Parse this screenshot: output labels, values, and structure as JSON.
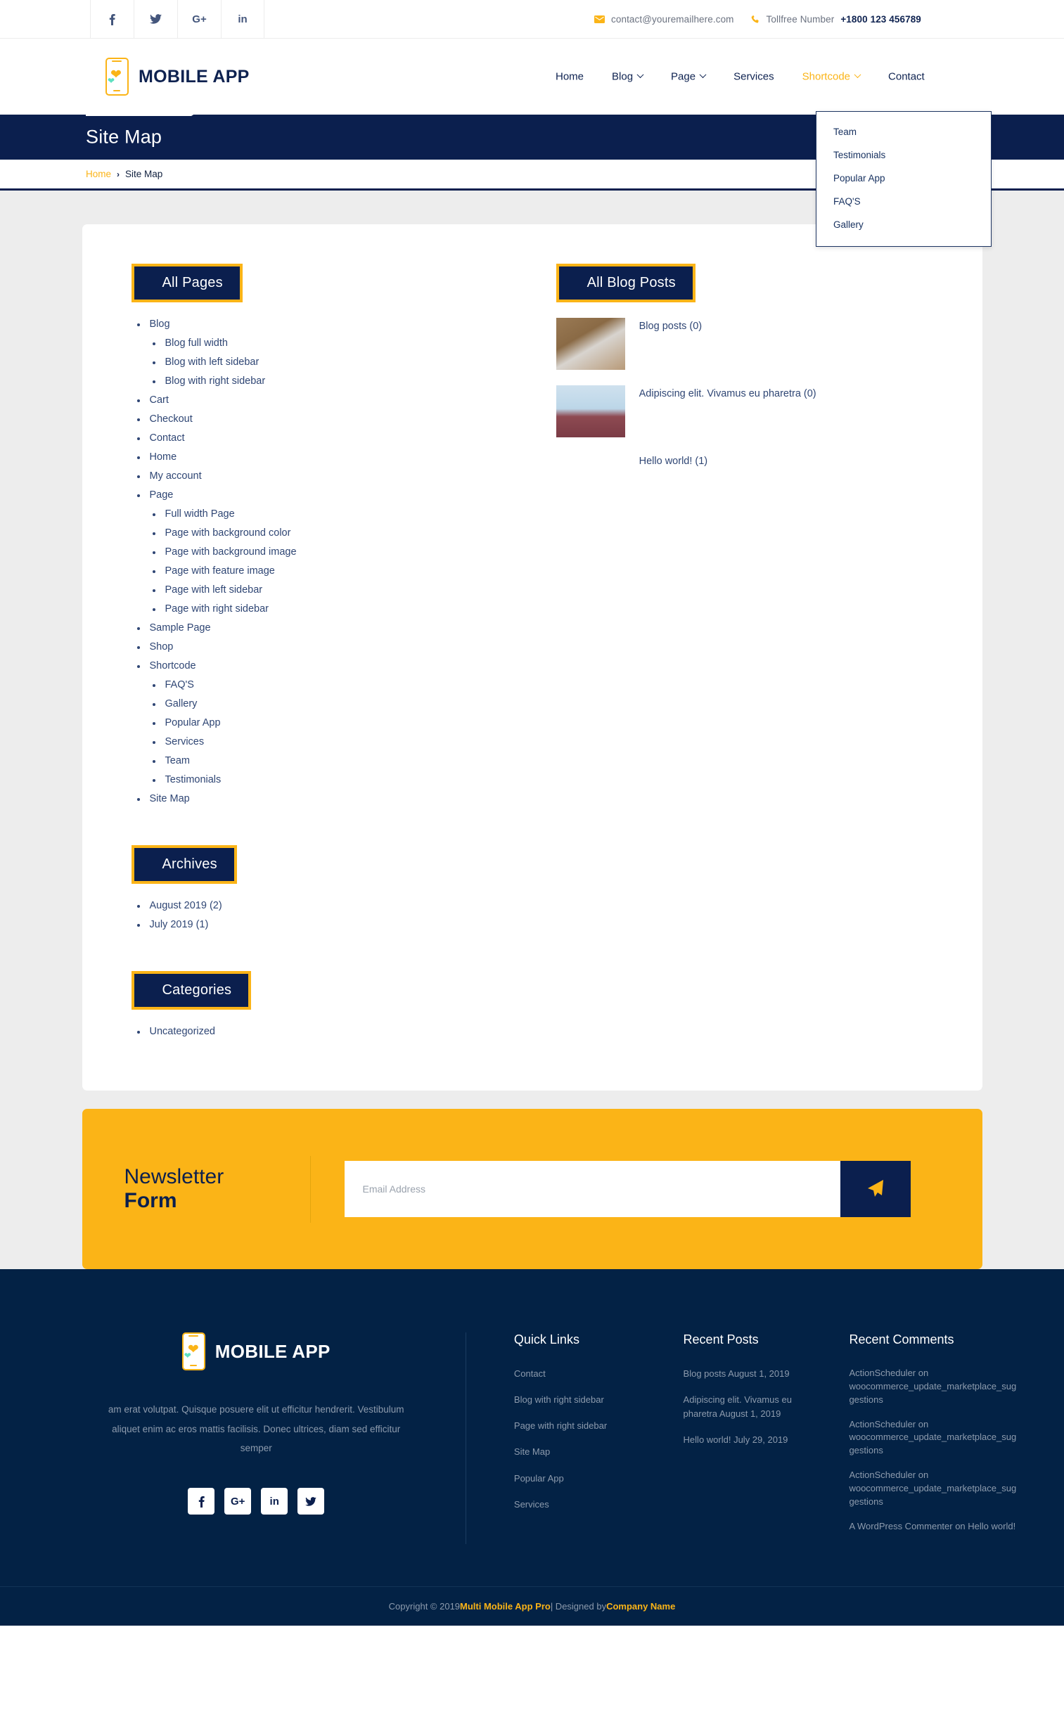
{
  "topbar": {
    "social": [
      {
        "name": "facebook-icon",
        "glyph": "f"
      },
      {
        "name": "twitter-icon",
        "glyph": "t"
      },
      {
        "name": "google-plus-icon",
        "glyph": "G+"
      },
      {
        "name": "linkedin-icon",
        "glyph": "in"
      }
    ],
    "email": "contact@youremailhere.com",
    "phone_label": "Tollfree Number",
    "phone_number": "+1800 123 456789"
  },
  "header": {
    "brand": "MOBILE APP",
    "nav": [
      {
        "label": "Home",
        "has_caret": false,
        "active": false
      },
      {
        "label": "Blog",
        "has_caret": true,
        "active": false
      },
      {
        "label": "Page",
        "has_caret": true,
        "active": false
      },
      {
        "label": "Services",
        "has_caret": false,
        "active": false
      },
      {
        "label": "Shortcode",
        "has_caret": true,
        "active": true
      },
      {
        "label": "Contact",
        "has_caret": false,
        "active": false
      }
    ],
    "dropdown": [
      "Team",
      "Testimonials",
      "Popular App",
      "FAQ'S",
      "Gallery"
    ]
  },
  "banner": {
    "title": "Site Map",
    "breadcrumb_home": "Home",
    "breadcrumb_sep": "›",
    "breadcrumb_current": "Site Map"
  },
  "sitemap": {
    "all_pages_title": "All Pages",
    "all_pages": [
      {
        "label": "Blog",
        "children": [
          "Blog full width",
          "Blog with left sidebar",
          "Blog with right sidebar"
        ]
      },
      {
        "label": "Cart",
        "children": []
      },
      {
        "label": "Checkout",
        "children": []
      },
      {
        "label": "Contact",
        "children": []
      },
      {
        "label": "Home",
        "children": []
      },
      {
        "label": "My account",
        "children": []
      },
      {
        "label": "Page",
        "children": [
          "Full width Page",
          "Page with background color",
          "Page with background image",
          "Page with feature image",
          "Page with left sidebar",
          "Page with right sidebar"
        ]
      },
      {
        "label": "Sample Page",
        "children": []
      },
      {
        "label": "Shop",
        "children": []
      },
      {
        "label": "Shortcode",
        "children": [
          "FAQ'S",
          "Gallery",
          "Popular App",
          "Services",
          "Team",
          "Testimonials"
        ]
      },
      {
        "label": "Site Map",
        "children": []
      }
    ],
    "archives_title": "Archives",
    "archives": [
      "August 2019 (2)",
      "July 2019 (1)"
    ],
    "categories_title": "Categories",
    "categories": [
      "Uncategorized"
    ],
    "all_blog_posts_title": "All Blog Posts",
    "blog_posts": [
      {
        "title": "Blog posts (0)",
        "thumb": "phone-in-hands-photo"
      },
      {
        "title": "Adipiscing elit. Vivamus eu pharetra (0)",
        "thumb": "man-with-phone-photo"
      },
      {
        "title": "Hello world! (1)",
        "thumb": ""
      }
    ]
  },
  "newsletter": {
    "line1": "Newsletter",
    "line2": "Form",
    "placeholder": "Email Address",
    "value": "",
    "submit_icon": "paper-plane-icon"
  },
  "footer": {
    "brand": "MOBILE APP",
    "description": "am erat volutpat. Quisque posuere elit ut efficitur hendrerit. Vestibulum aliquet enim ac eros mattis facilisis. Donec ultrices, diam sed efficitur semper",
    "social": [
      {
        "name": "facebook-icon",
        "glyph": "f"
      },
      {
        "name": "google-plus-icon",
        "glyph": "G+"
      },
      {
        "name": "linkedin-icon",
        "glyph": "in"
      },
      {
        "name": "twitter-icon",
        "glyph": "t"
      }
    ],
    "quick_links_title": "Quick Links",
    "quick_links": [
      "Contact",
      "Blog with right sidebar",
      "Page with right sidebar",
      "Site Map",
      "Popular App",
      "Services"
    ],
    "recent_posts_title": "Recent Posts",
    "recent_posts": [
      "Blog posts August 1, 2019",
      "Adipiscing elit. Vivamus eu pharetra August 1, 2019",
      "Hello world! July 29, 2019"
    ],
    "recent_comments_title": "Recent Comments",
    "recent_comments": [
      "ActionScheduler on woocommerce_update_marketplace_suggestions",
      "ActionScheduler on woocommerce_update_marketplace_suggestions",
      "ActionScheduler on woocommerce_update_marketplace_suggestions",
      "A WordPress Commenter on Hello world!"
    ],
    "copyright_prefix": "Copyright © 2019 ",
    "copyright_brand": "Multi Mobile App Pro",
    "copyright_mid": " | Designed by ",
    "copyright_company": "Company Name"
  },
  "colors": {
    "navy": "#0b1f4e",
    "footer_navy": "#032245",
    "accent": "#fbb417",
    "page_bg": "#ededed",
    "link": "#2f4674"
  }
}
